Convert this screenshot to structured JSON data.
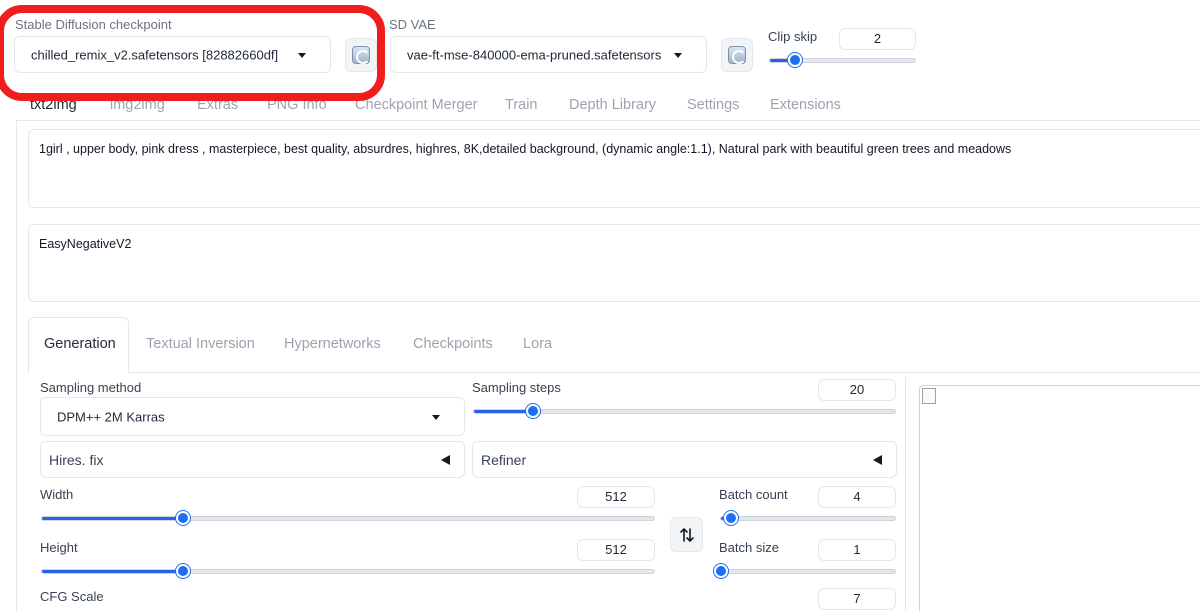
{
  "checkpoint": {
    "label": "Stable Diffusion checkpoint",
    "value": "chilled_remix_v2.safetensors [82882660df]"
  },
  "vae": {
    "label": "SD VAE",
    "value": "vae-ft-mse-840000-ema-pruned.safetensors"
  },
  "clip_skip": {
    "label": "Clip skip",
    "value": "2",
    "fraction": 0.17
  },
  "main_tabs": [
    "txt2img",
    "img2img",
    "Extras",
    "PNG Info",
    "Checkpoint Merger",
    "Train",
    "Depth Library",
    "Settings",
    "Extensions"
  ],
  "prompt": "1girl , upper body, pink dress , masterpiece, best quality, absurdres, highres, 8K,detailed background, (dynamic angle:1.1), Natural park with beautiful green trees and meadows",
  "negative_prompt": "EasyNegativeV2",
  "sub_tabs": [
    "Generation",
    "Textual Inversion",
    "Hypernetworks",
    "Checkpoints",
    "Lora"
  ],
  "sampling_method": {
    "label": "Sampling method",
    "value": "DPM++ 2M Karras"
  },
  "sampling_steps": {
    "label": "Sampling steps",
    "value": "20",
    "fraction": 0.14
  },
  "hires_fix": {
    "label": "Hires. fix"
  },
  "refiner": {
    "label": "Refiner"
  },
  "width": {
    "label": "Width",
    "value": "512",
    "fraction": 0.23
  },
  "height": {
    "label": "Height",
    "value": "512",
    "fraction": 0.23
  },
  "batch_count": {
    "label": "Batch count",
    "value": "4",
    "fraction": 0.06
  },
  "batch_size": {
    "label": "Batch size",
    "value": "1",
    "fraction": 0.0
  },
  "cfg_scale": {
    "label": "CFG Scale",
    "value": "7"
  },
  "swap_icon": "swap-vertical-arrows",
  "colors": {
    "accent": "#2563eb",
    "highlight": "#f01d1d"
  }
}
